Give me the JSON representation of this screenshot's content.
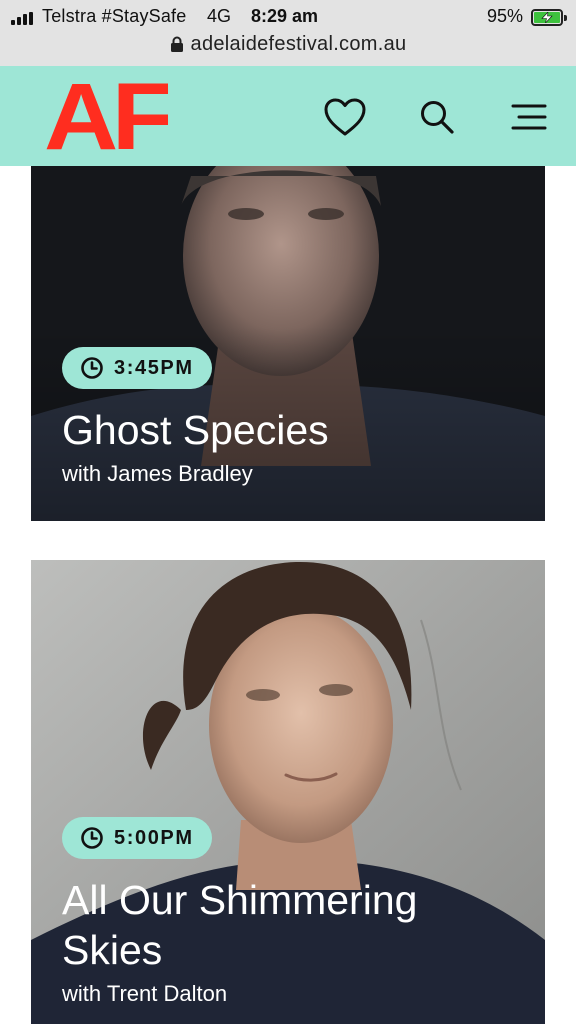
{
  "status_bar": {
    "carrier": "Telstra #StaySafe",
    "network": "4G",
    "time": "8:29 am",
    "battery_percent": "95%",
    "battery_level": 0.95,
    "charging": true,
    "url": "adelaidefestival.com.au"
  },
  "header": {
    "logo_text": "AF",
    "logo_color": "#ff2d1f",
    "background_color": "#9ee6d6",
    "icons": [
      "heart-icon",
      "search-icon",
      "menu-icon"
    ]
  },
  "events": [
    {
      "time": "3:45PM",
      "title": "Ghost Species",
      "subtitle": "with James Bradley"
    },
    {
      "time": "5:00PM",
      "title": "All Our Shimmering Skies",
      "subtitle": "with Trent Dalton"
    }
  ]
}
